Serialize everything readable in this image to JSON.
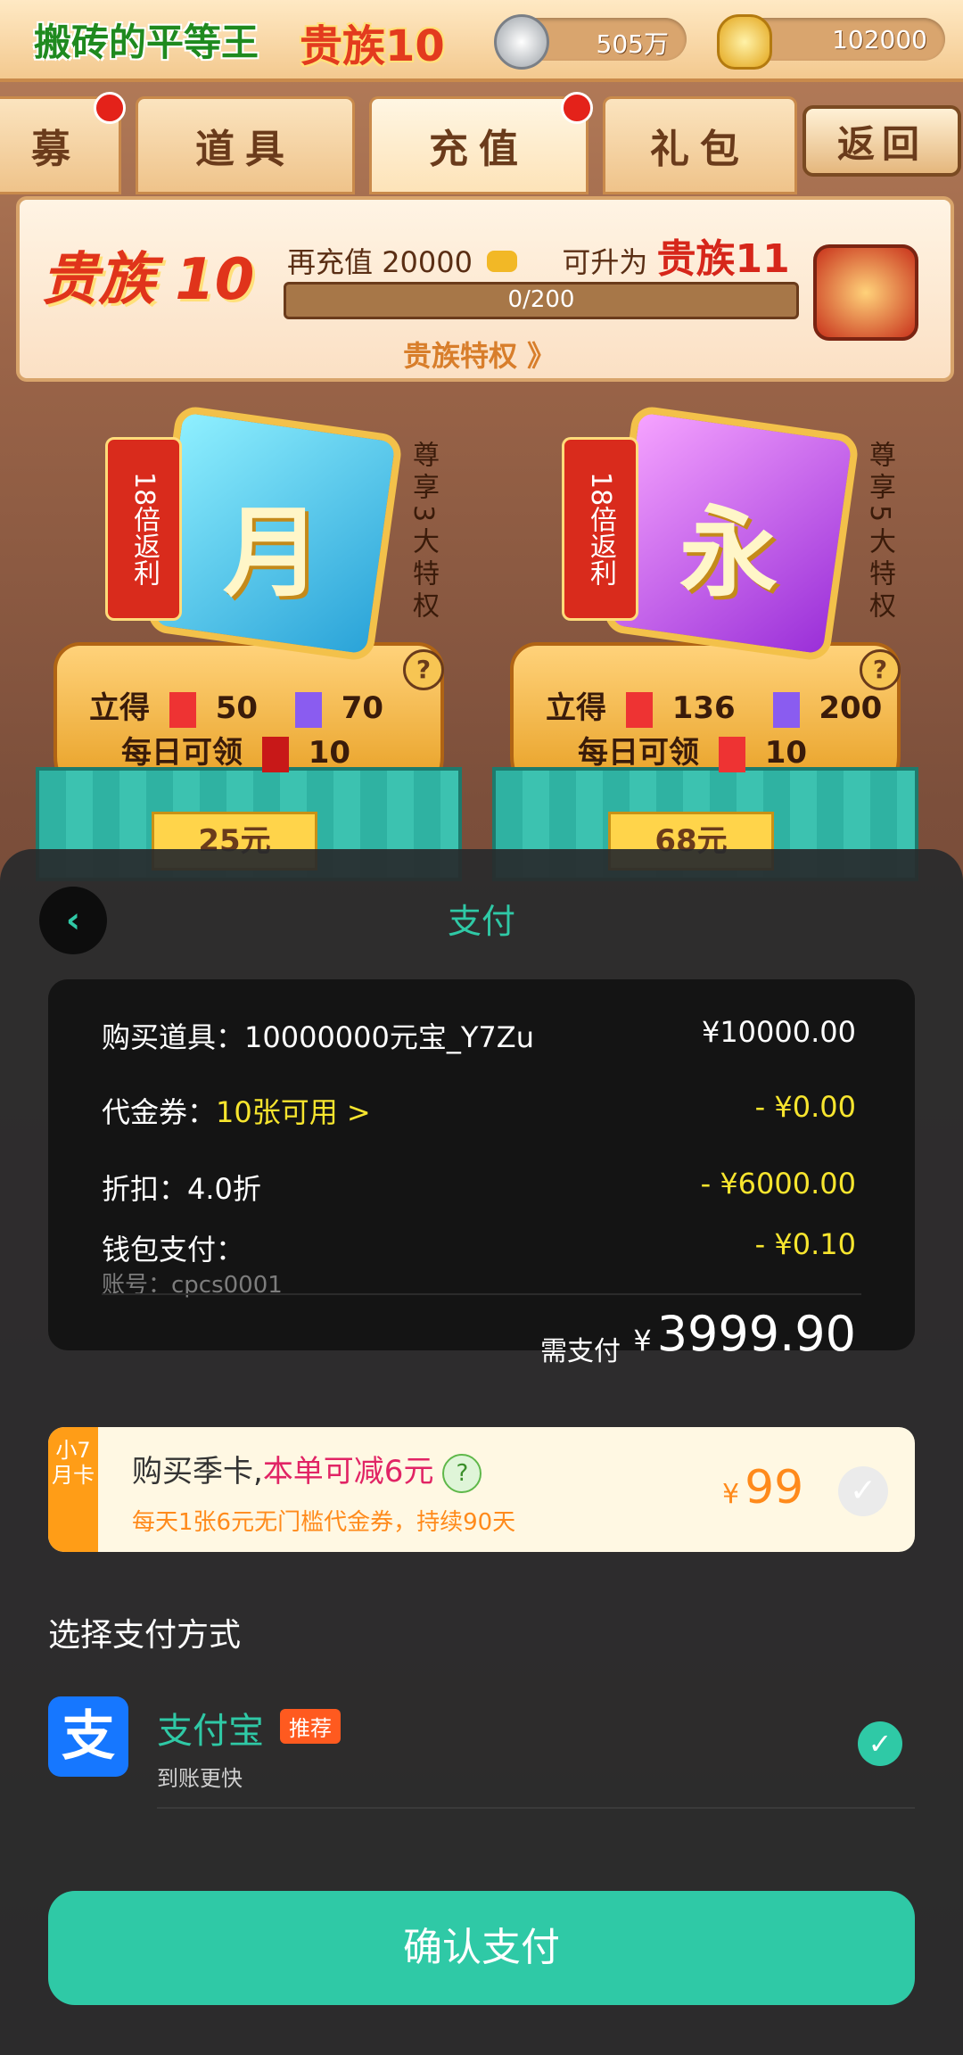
{
  "game": {
    "player_name": "搬砖的平等王",
    "vip_label": "贵族10",
    "silver": "505万",
    "gold": "102000",
    "tabs": [
      "募",
      "道具",
      "充值",
      "礼包"
    ],
    "back_label": "返回",
    "vip_panel": {
      "level": "贵族 10",
      "recharge_prefix": "再充值",
      "recharge_amount": "20000",
      "upgrade_prefix": "可升为",
      "next_level": "贵族11",
      "progress_text": "0/200",
      "progress": 0,
      "privilege_link": "贵族特权 》"
    },
    "cards": [
      {
        "badge": "18倍返利",
        "char": "月",
        "side": "尊享3大特权",
        "q": "?",
        "row1_label": "立得",
        "row1_a": "50",
        "row1_b": "70",
        "row2_label": "每日可领",
        "row2_val": "10",
        "price": "25元"
      },
      {
        "badge": "18倍返利",
        "char": "永",
        "side": "尊享5大特权",
        "q": "?",
        "row1_label": "立得",
        "row1_a": "136",
        "row1_b": "200",
        "row2_label": "每日可领",
        "row2_val": "10",
        "price": "68元"
      }
    ]
  },
  "payment": {
    "back_icon": "‹",
    "title": "支付",
    "item_label": "购买道具：10000000元宝_Y7Zu",
    "item_price": "¥10000.00",
    "coupon_label": "代金券：",
    "coupon_value": "10张可用 >",
    "coupon_amount": "- ¥0.00",
    "discount_label": "折扣：4.0折",
    "discount_amount": "- ¥6000.00",
    "wallet_label": "钱包支付：",
    "wallet_amount": "- ¥0.10",
    "account": "账号：cpcs0001",
    "total_label": "需支付",
    "total_currency": "¥",
    "total_value": "3999.90",
    "promo": {
      "tag": "小7月卡",
      "title_prefix": "购买季卡,",
      "title_highlight": "本单可减6元",
      "qmark": "?",
      "subtitle": "每天1张6元无门槛代金券，持续90天",
      "currency": "¥",
      "price": "99",
      "check": "✓"
    },
    "methods_title": "选择支付方式",
    "method": {
      "logo": "支",
      "name": "支付宝",
      "badge": "推荐",
      "desc": "到账更快",
      "check": "✓"
    },
    "confirm_label": "确认支付"
  }
}
